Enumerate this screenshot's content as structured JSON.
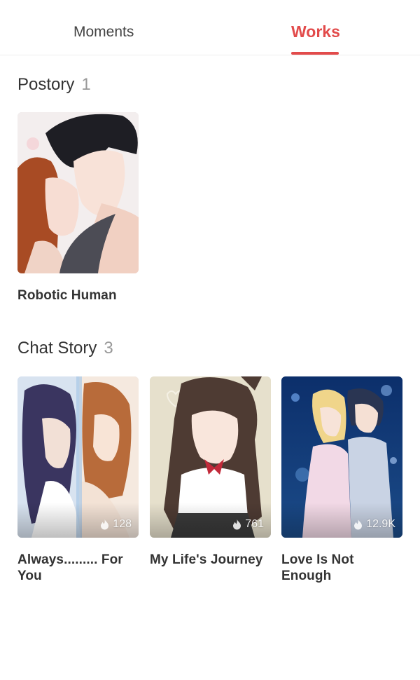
{
  "tabs": [
    {
      "label": "Moments",
      "active": false
    },
    {
      "label": "Works",
      "active": true
    }
  ],
  "accent_color": "#e24b4b",
  "postory": {
    "title": "Postory",
    "count": "1",
    "items": [
      {
        "title": "Robotic Human",
        "cover": "illustration-couple-embrace"
      }
    ]
  },
  "chat_story": {
    "title": "Chat Story",
    "count": "3",
    "items": [
      {
        "title": "Always......... For You",
        "views": "128",
        "cover": "illustration-split-portrait"
      },
      {
        "title": "My Life's Journey",
        "views": "761",
        "cover": "illustration-schoolgirl"
      },
      {
        "title": "Love Is Not Enough",
        "views": "12.9K",
        "cover": "illustration-night-couple"
      }
    ]
  },
  "icons": {
    "views": "fire-icon"
  }
}
